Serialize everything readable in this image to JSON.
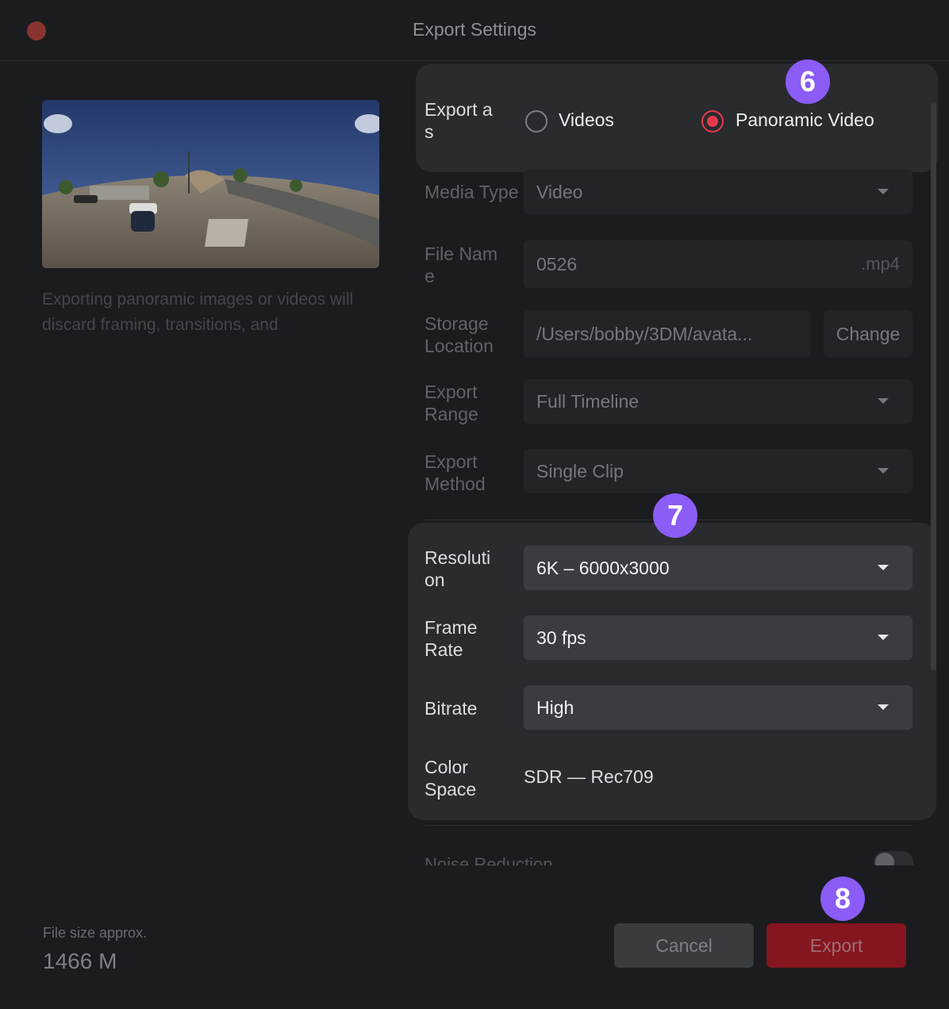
{
  "window": {
    "title": "Export Settings"
  },
  "sidebar": {
    "notice": "Exporting panoramic images or videos will discard framing, transitions, and",
    "file_size_label": "File size approx.",
    "file_size_value": "1466 M"
  },
  "export_as": {
    "label": "Export a s",
    "options": [
      {
        "label": "Videos",
        "selected": false
      },
      {
        "label": "Panoramic Video",
        "selected": true
      }
    ]
  },
  "media_type": {
    "label": "Media Type",
    "value": "Video"
  },
  "file_name": {
    "label": "File Nam e",
    "value": "0526",
    "suffix": ".mp4"
  },
  "storage": {
    "label": "Storage Location",
    "value": "/Users/bobby/3DM/avata...",
    "button": "Change"
  },
  "export_range": {
    "label": "Export Range",
    "value": "Full Timeline"
  },
  "export_method": {
    "label": "Export Method",
    "value": "Single Clip"
  },
  "resolution": {
    "label": "Resoluti on",
    "value": "6K – 6000x3000"
  },
  "frame_rate": {
    "label": "Frame Rate",
    "value": "30 fps"
  },
  "bitrate": {
    "label": "Bitrate",
    "value": "High"
  },
  "color_space": {
    "label": "Color Space",
    "value": "SDR — Rec709"
  },
  "noise_reduction": {
    "label": "Noise Reduction",
    "enabled": false
  },
  "footer": {
    "cancel": "Cancel",
    "export": "Export"
  },
  "annotations": [
    "6",
    "7",
    "8"
  ],
  "colors": {
    "accent": "#e63a4c",
    "badge": "#8b5cf6",
    "export_button": "#85151f"
  }
}
